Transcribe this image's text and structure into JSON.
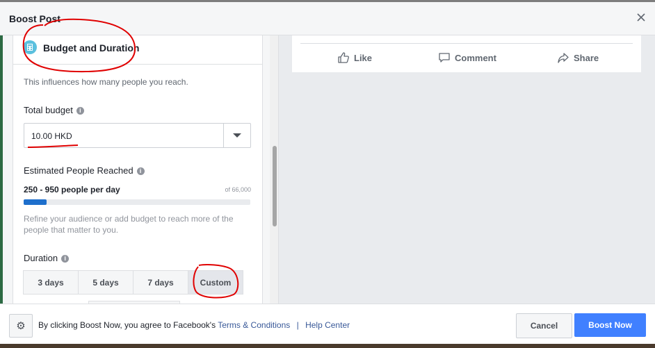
{
  "header": {
    "title": "Boost Post",
    "close_icon": "close-icon"
  },
  "section": {
    "title": "Budget and Duration",
    "icon": "budget-icon",
    "subtitle": "This influences how many people you reach."
  },
  "budget": {
    "label": "Total budget",
    "value": "10.00 HKD"
  },
  "reach": {
    "label": "Estimated People Reached",
    "range": "250 - 950 people per day",
    "total": "of 66,000",
    "progress_fraction": 0.1,
    "hint": "Refine your audience or add budget to reach more of the people that matter to you."
  },
  "duration": {
    "label": "Duration",
    "options": [
      {
        "label": "3 days",
        "selected": false
      },
      {
        "label": "5 days",
        "selected": false
      },
      {
        "label": "7 days",
        "selected": false
      },
      {
        "label": "Custom",
        "selected": true
      }
    ]
  },
  "post_actions": {
    "like": "Like",
    "comment": "Comment",
    "share": "Share"
  },
  "footer": {
    "agreement": "By clicking Boost Now, you agree to Facebook's",
    "terms_link": "Terms & Conditions",
    "separator": "|",
    "help_link": "Help Center",
    "cancel": "Cancel",
    "boost": "Boost Now"
  },
  "colors": {
    "primary_button": "#4080ff",
    "progress": "#1e6fcc",
    "link": "#385898",
    "annotation": "#e00000"
  }
}
